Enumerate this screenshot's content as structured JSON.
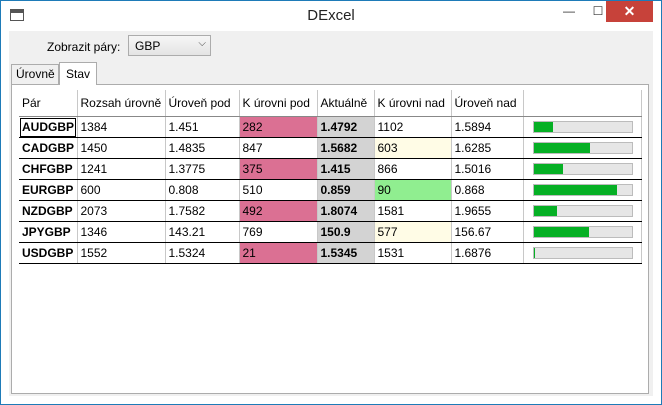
{
  "window": {
    "title": "DExcel",
    "minimize_glyph": "—",
    "maximize_glyph": "☐",
    "close_glyph": "✕"
  },
  "filter": {
    "label": "Zobrazit páry:",
    "selected": "GBP",
    "icon": "chevron-down-icon"
  },
  "tabs": [
    {
      "label": "Úrovně",
      "active": false
    },
    {
      "label": "Stav",
      "active": true
    }
  ],
  "table": {
    "columns": [
      "Pár",
      "Rozsah úrovně",
      "Úroveň pod",
      "K úrovni pod",
      "Aktuálně",
      "K úrovni nad",
      "Úroveň nad",
      ""
    ],
    "rows": [
      {
        "pair": "AUDGBP",
        "range": "1384",
        "level_below": "1.451",
        "to_below": "282",
        "current": "1.4792",
        "to_above": "1102",
        "level_above": "1.5894",
        "progress": 0.2
      },
      {
        "pair": "CADGBP",
        "range": "1450",
        "level_below": "1.4835",
        "to_below": "847",
        "current": "1.5682",
        "to_above": "603",
        "level_above": "1.6285",
        "progress": 0.58
      },
      {
        "pair": "CHFGBP",
        "range": "1241",
        "level_below": "1.3775",
        "to_below": "375",
        "current": "1.415",
        "to_above": "866",
        "level_above": "1.5016",
        "progress": 0.3
      },
      {
        "pair": "EURGBP",
        "range": "600",
        "level_below": "0.808",
        "to_below": "510",
        "current": "0.859",
        "to_above": "90",
        "level_above": "0.868",
        "progress": 0.85
      },
      {
        "pair": "NZDGBP",
        "range": "2073",
        "level_below": "1.7582",
        "to_below": "492",
        "current": "1.8074",
        "to_above": "1581",
        "level_above": "1.9655",
        "progress": 0.24
      },
      {
        "pair": "JPYGBP",
        "range": "1346",
        "level_below": "143.21",
        "to_below": "769",
        "current": "150.9",
        "to_above": "577",
        "level_above": "156.67",
        "progress": 0.57
      },
      {
        "pair": "USDGBP",
        "range": "1552",
        "level_below": "1.5324",
        "to_below": "21",
        "current": "1.5345",
        "to_above": "1531",
        "level_above": "1.6876",
        "progress": 0.02
      }
    ],
    "colors": {
      "near_below": "#db7093",
      "near_above": "#fffce6",
      "very_near_above": "#90ee90",
      "current_bg": "#d3d3d3",
      "progress_fill": "#06b025"
    }
  }
}
